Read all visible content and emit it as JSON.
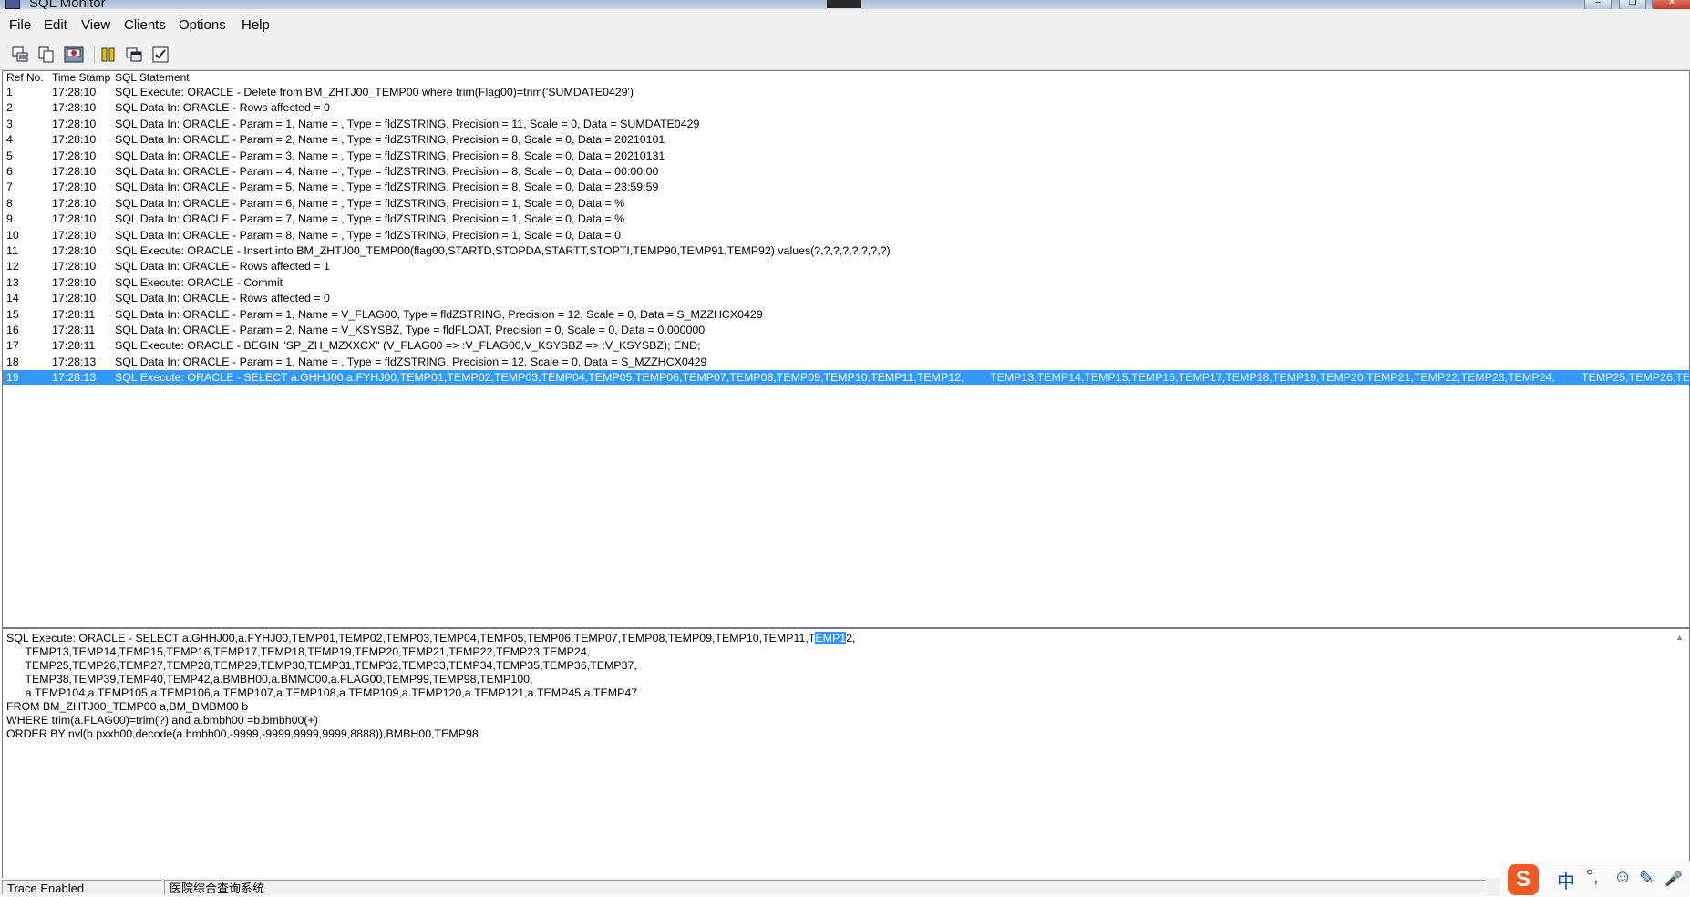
{
  "window": {
    "title": "SQL Monitor",
    "buttons": [
      "–",
      "❐",
      "✕"
    ]
  },
  "menu": [
    "File",
    "Edit",
    "View",
    "Clients",
    "Options",
    "Help"
  ],
  "toolbar": {
    "icons": [
      "clear-log-icon",
      "copy-icon",
      "save-icon",
      "pause-icon",
      "window-icon",
      "checklist-icon"
    ]
  },
  "grid": {
    "columns": [
      "Ref No.",
      "Time Stamp",
      "SQL Statement"
    ],
    "selected_ref": "19",
    "rows": [
      {
        "ref": "1",
        "time": "17:28:10",
        "sql": "SQL Execute: ORACLE - Delete from BM_ZHTJ00_TEMP00 where trim(Flag00)=trim('SUMDATE0429')"
      },
      {
        "ref": "2",
        "time": "17:28:10",
        "sql": "SQL Data In: ORACLE - Rows affected = 0"
      },
      {
        "ref": "3",
        "time": "17:28:10",
        "sql": "SQL Data In: ORACLE - Param = 1, Name = , Type = fldZSTRING, Precision = 11, Scale = 0, Data = SUMDATE0429"
      },
      {
        "ref": "4",
        "time": "17:28:10",
        "sql": "SQL Data In: ORACLE - Param = 2, Name = , Type = fldZSTRING, Precision = 8, Scale = 0, Data = 20210101"
      },
      {
        "ref": "5",
        "time": "17:28:10",
        "sql": "SQL Data In: ORACLE - Param = 3, Name = , Type = fldZSTRING, Precision = 8, Scale = 0, Data = 20210131"
      },
      {
        "ref": "6",
        "time": "17:28:10",
        "sql": "SQL Data In: ORACLE - Param = 4, Name = , Type = fldZSTRING, Precision = 8, Scale = 0, Data = 00:00:00"
      },
      {
        "ref": "7",
        "time": "17:28:10",
        "sql": "SQL Data In: ORACLE - Param = 5, Name = , Type = fldZSTRING, Precision = 8, Scale = 0, Data = 23:59:59"
      },
      {
        "ref": "8",
        "time": "17:28:10",
        "sql": "SQL Data In: ORACLE - Param = 6, Name = , Type = fldZSTRING, Precision = 1, Scale = 0, Data = %"
      },
      {
        "ref": "9",
        "time": "17:28:10",
        "sql": "SQL Data In: ORACLE - Param = 7, Name = , Type = fldZSTRING, Precision = 1, Scale = 0, Data = %"
      },
      {
        "ref": "10",
        "time": "17:28:10",
        "sql": "SQL Data In: ORACLE - Param = 8, Name = , Type = fldZSTRING, Precision = 1, Scale = 0, Data = 0"
      },
      {
        "ref": "11",
        "time": "17:28:10",
        "sql": "SQL Execute: ORACLE - Insert into BM_ZHTJ00_TEMP00(flag00,STARTD,STOPDA,STARTT,STOPTI,TEMP90,TEMP91,TEMP92) values(?,?,?,?,?,?,?,?)"
      },
      {
        "ref": "12",
        "time": "17:28:10",
        "sql": "SQL Data In: ORACLE - Rows affected = 1"
      },
      {
        "ref": "13",
        "time": "17:28:10",
        "sql": "SQL Execute: ORACLE - Commit"
      },
      {
        "ref": "14",
        "time": "17:28:10",
        "sql": "SQL Data In: ORACLE - Rows affected = 0"
      },
      {
        "ref": "15",
        "time": "17:28:11",
        "sql": "SQL Data In: ORACLE - Param = 1, Name = V_FLAG00, Type = fldZSTRING, Precision = 12, Scale = 0, Data = S_MZZHCX0429"
      },
      {
        "ref": "16",
        "time": "17:28:11",
        "sql": "SQL Data In: ORACLE - Param = 2, Name = V_KSYSBZ, Type = fldFLOAT, Precision = 0, Scale = 0, Data = 0.000000"
      },
      {
        "ref": "17",
        "time": "17:28:11",
        "sql": "SQL Execute: ORACLE - BEGIN \"SP_ZH_MZXXCX\" (V_FLAG00 => :V_FLAG00,V_KSYSBZ => :V_KSYSBZ); END;"
      },
      {
        "ref": "18",
        "time": "17:28:13",
        "sql": "SQL Data In: ORACLE - Param = 1, Name = , Type = fldZSTRING, Precision = 12, Scale = 0, Data = S_MZZHCX0429"
      },
      {
        "ref": "19",
        "time": "17:28:13",
        "sql": "SQL Execute: ORACLE - SELECT a.GHHJ00,a.FYHJ00,TEMP01,TEMP02,TEMP03,TEMP04,TEMP05,TEMP06,TEMP07,TEMP08,TEMP09,TEMP10,TEMP11,TEMP12,",
        "sql_seg2": "TEMP13,TEMP14,TEMP15,TEMP16,TEMP17,TEMP18,TEMP19,TEMP20,TEMP21,TEMP22,TEMP23,TEMP24,",
        "sql_seg3": "TEMP25,TEMP26,TE"
      }
    ]
  },
  "detail": {
    "line1_before": "SQL Execute: ORACLE - SELECT a.GHHJ00,a.FYHJ00,TEMP01,TEMP02,TEMP03,TEMP04,TEMP05,TEMP06,TEMP07,TEMP08,TEMP09,TEMP10,TEMP11,T",
    "line1_selected": "EMP1",
    "line1_after": "2,",
    "lines": [
      "      TEMP13,TEMP14,TEMP15,TEMP16,TEMP17,TEMP18,TEMP19,TEMP20,TEMP21,TEMP22,TEMP23,TEMP24,",
      "      TEMP25,TEMP26,TEMP27,TEMP28,TEMP29,TEMP30,TEMP31,TEMP32,TEMP33,TEMP34,TEMP35,TEMP36,TEMP37,",
      "      TEMP38,TEMP39,TEMP40,TEMP42,a.BMBH00,a.BMMC00,a.FLAG00,TEMP99,TEMP98,TEMP100,",
      "      a.TEMP104,a.TEMP105,a.TEMP106,a.TEMP107,a.TEMP108,a.TEMP109,a.TEMP120,a.TEMP121,a.TEMP45,a.TEMP47",
      "FROM BM_ZHTJ00_TEMP00 a,BM_BMBM00 b",
      "WHERE trim(a.FLAG00)=trim(?) and a.bmbh00 =b.bmbh00(+)",
      "ORDER BY nvl(b.pxxh00,decode(a.bmbh00,-9999,-9999,9999,9999,8888)),BMBH00,TEMP98"
    ]
  },
  "status": {
    "trace": "Trace Enabled",
    "client": "医院综合查询系统"
  },
  "ime": {
    "logo": "S",
    "items": [
      "中",
      "°,",
      "☺",
      "✎",
      "🎤"
    ]
  }
}
